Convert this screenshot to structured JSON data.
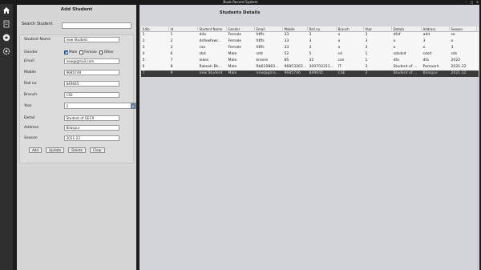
{
  "window": {
    "title": "Book Record System"
  },
  "sidebar": {
    "icons": [
      "home-icon",
      "document-icon",
      "add-icon",
      "settings-icon"
    ]
  },
  "left_panel": {
    "title": "Add Student",
    "search_label": "Search Student",
    "search_value": "",
    "form": {
      "student_name": {
        "label": "Student Name",
        "value": "new Student"
      },
      "gender": {
        "label": "Gender",
        "options": [
          "Male",
          "Female",
          "Other"
        ],
        "selected": "Male"
      },
      "email": {
        "label": "Email",
        "value": "new@gmail.com"
      },
      "mobile": {
        "label": "Mobile",
        "value": "9685749"
      },
      "rollno": {
        "label": "Roll no",
        "value": "849645"
      },
      "branch": {
        "label": "Branch",
        "value": "CSE"
      },
      "year": {
        "label": "Year",
        "value": "2"
      },
      "detail": {
        "label": "Detail",
        "value": "Student of GECR"
      },
      "address": {
        "label": "Address",
        "value": "Bilaspur"
      },
      "season": {
        "label": "Season",
        "value": "2021-22"
      }
    },
    "buttons": {
      "add": "Add",
      "update": "Update",
      "delete": "Delete",
      "clear": "Clear"
    }
  },
  "right_panel": {
    "title": "Students Details",
    "columns": [
      "S.No",
      "id",
      "Student Name",
      "Gender",
      "Email",
      "Mobile",
      "Roll no.",
      "Branch",
      "Year",
      "Details",
      "Address",
      "Season"
    ],
    "rows": [
      [
        "1",
        "1",
        "ddo",
        "Female",
        "fdffs",
        "33",
        "3",
        "o",
        "3",
        "dfaf",
        "add",
        "se"
      ],
      [
        "2",
        "2",
        "dsfewfewr...",
        "Female",
        "fdffs",
        "33",
        "3",
        "o",
        "3",
        "o",
        "3",
        "o"
      ],
      [
        "3",
        "3",
        "raa",
        "Female",
        "fdffs",
        "33",
        "3",
        "o",
        "3",
        "o",
        "o",
        "3"
      ],
      [
        "4",
        "6",
        "sbd",
        "Male",
        "sdd",
        "52",
        "5",
        "sd",
        "1",
        "sdsdsd",
        "sdsd",
        "sds"
      ],
      [
        "5",
        "7",
        "lokes",
        "Male",
        "kreere",
        "85",
        "32",
        "cse",
        "1",
        "dfa",
        "dfa",
        "2022"
      ],
      [
        "6",
        "8",
        "Rakesh Bh...",
        "Male",
        "Rb610883...",
        "96853262...",
        "300703311...",
        "IT",
        "3",
        "Student of ...",
        "Pamoarh",
        "2021-22"
      ],
      [
        "7",
        "9",
        "new Student",
        "Male",
        "new@gma...",
        "9685746",
        "849645",
        "CSE",
        "2",
        "Student of ...",
        "Bilaspur",
        "2021-22"
      ]
    ],
    "selected_row": 6
  }
}
